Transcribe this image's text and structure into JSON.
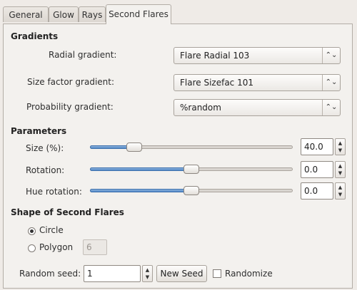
{
  "tabs": [
    {
      "label": "General"
    },
    {
      "label": "Glow"
    },
    {
      "label": "Rays"
    },
    {
      "label": "Second Flares"
    }
  ],
  "active_tab": "Second Flares",
  "gradients": {
    "title": "Gradients",
    "radial": {
      "label": "Radial gradient:",
      "value": "Flare Radial 103"
    },
    "size_factor": {
      "label": "Size factor gradient:",
      "value": "Flare Sizefac 101"
    },
    "probability": {
      "label": "Probability gradient:",
      "value": "%random"
    }
  },
  "parameters": {
    "title": "Parameters",
    "size": {
      "label": "Size (%):",
      "value": "40.0",
      "fraction": 0.22
    },
    "rotation": {
      "label": "Rotation:",
      "value": "0.0",
      "fraction": 0.5
    },
    "hue_rotation": {
      "label": "Hue rotation:",
      "value": "0.0",
      "fraction": 0.5
    }
  },
  "shape": {
    "title": "Shape of Second Flares",
    "circle_label": "Circle",
    "polygon_label": "Polygon",
    "polygon_sides": "6",
    "selected": "circle"
  },
  "seed": {
    "label": "Random seed:",
    "value": "1",
    "new_seed_label": "New Seed",
    "randomize_label": "Randomize",
    "randomize_checked": false
  },
  "icons": {
    "combo_arrow": "up-down-chevron-icon",
    "spin_up": "chevron-up-icon",
    "spin_down": "chevron-down-icon"
  },
  "colors": {
    "accent": "#4f86c6",
    "window_bg": "#efebe7",
    "panel_bg": "#f3f1ee"
  }
}
